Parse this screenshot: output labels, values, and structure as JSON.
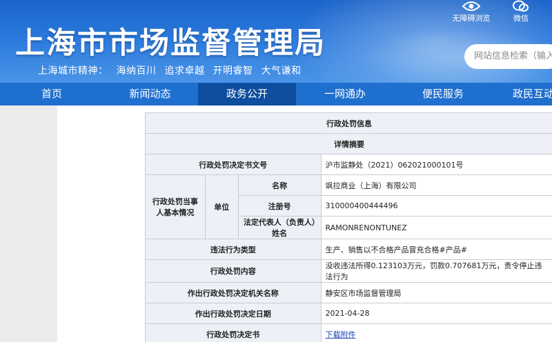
{
  "header": {
    "title": "上海市市场监督管理局",
    "slogan": [
      "上海城市精神：",
      "海纳百川",
      "追求卓越",
      "开明睿智",
      "大气谦和"
    ],
    "tools": {
      "accessibility_label": "无障碍浏览",
      "wechat_label": "微信"
    },
    "search_placeholder": "网站信息检索（输入"
  },
  "nav": {
    "items": [
      "首页",
      "新闻动态",
      "政务公开",
      "一网通办",
      "便民服务",
      "政民互动"
    ],
    "active_index": 2
  },
  "table": {
    "title": "行政处罚信息",
    "summary": "详情摘要",
    "doc_no_label": "行政处罚决定书文号",
    "doc_no_value": "沪市监静处（2021）062021000101号",
    "party_label": "行政处罚当事人基本情况",
    "unit_label": "单位",
    "name_label": "名称",
    "name_value": "飒拉商业（上海）有限公司",
    "reg_label": "注册号",
    "reg_value": "310000400444496",
    "rep_label": "法定代表人（负责人）姓名",
    "rep_value": "RAMONRENONTUNEZ",
    "violation_label": "违法行为类型",
    "violation_value": "生产、销售以不合格产品冒充合格#产品#",
    "content_label": "行政处罚内容",
    "content_value": "没收违法所得0.123103万元，罚款0.707681万元，责令停止违法行为",
    "org_label": "作出行政处罚决定机关名称",
    "org_value": "静安区市场监督管理局",
    "date_label": "作出行政处罚决定日期",
    "date_value": "2021-04-28",
    "decision_label": "行政处罚决定书",
    "decision_link": "下载附件"
  }
}
